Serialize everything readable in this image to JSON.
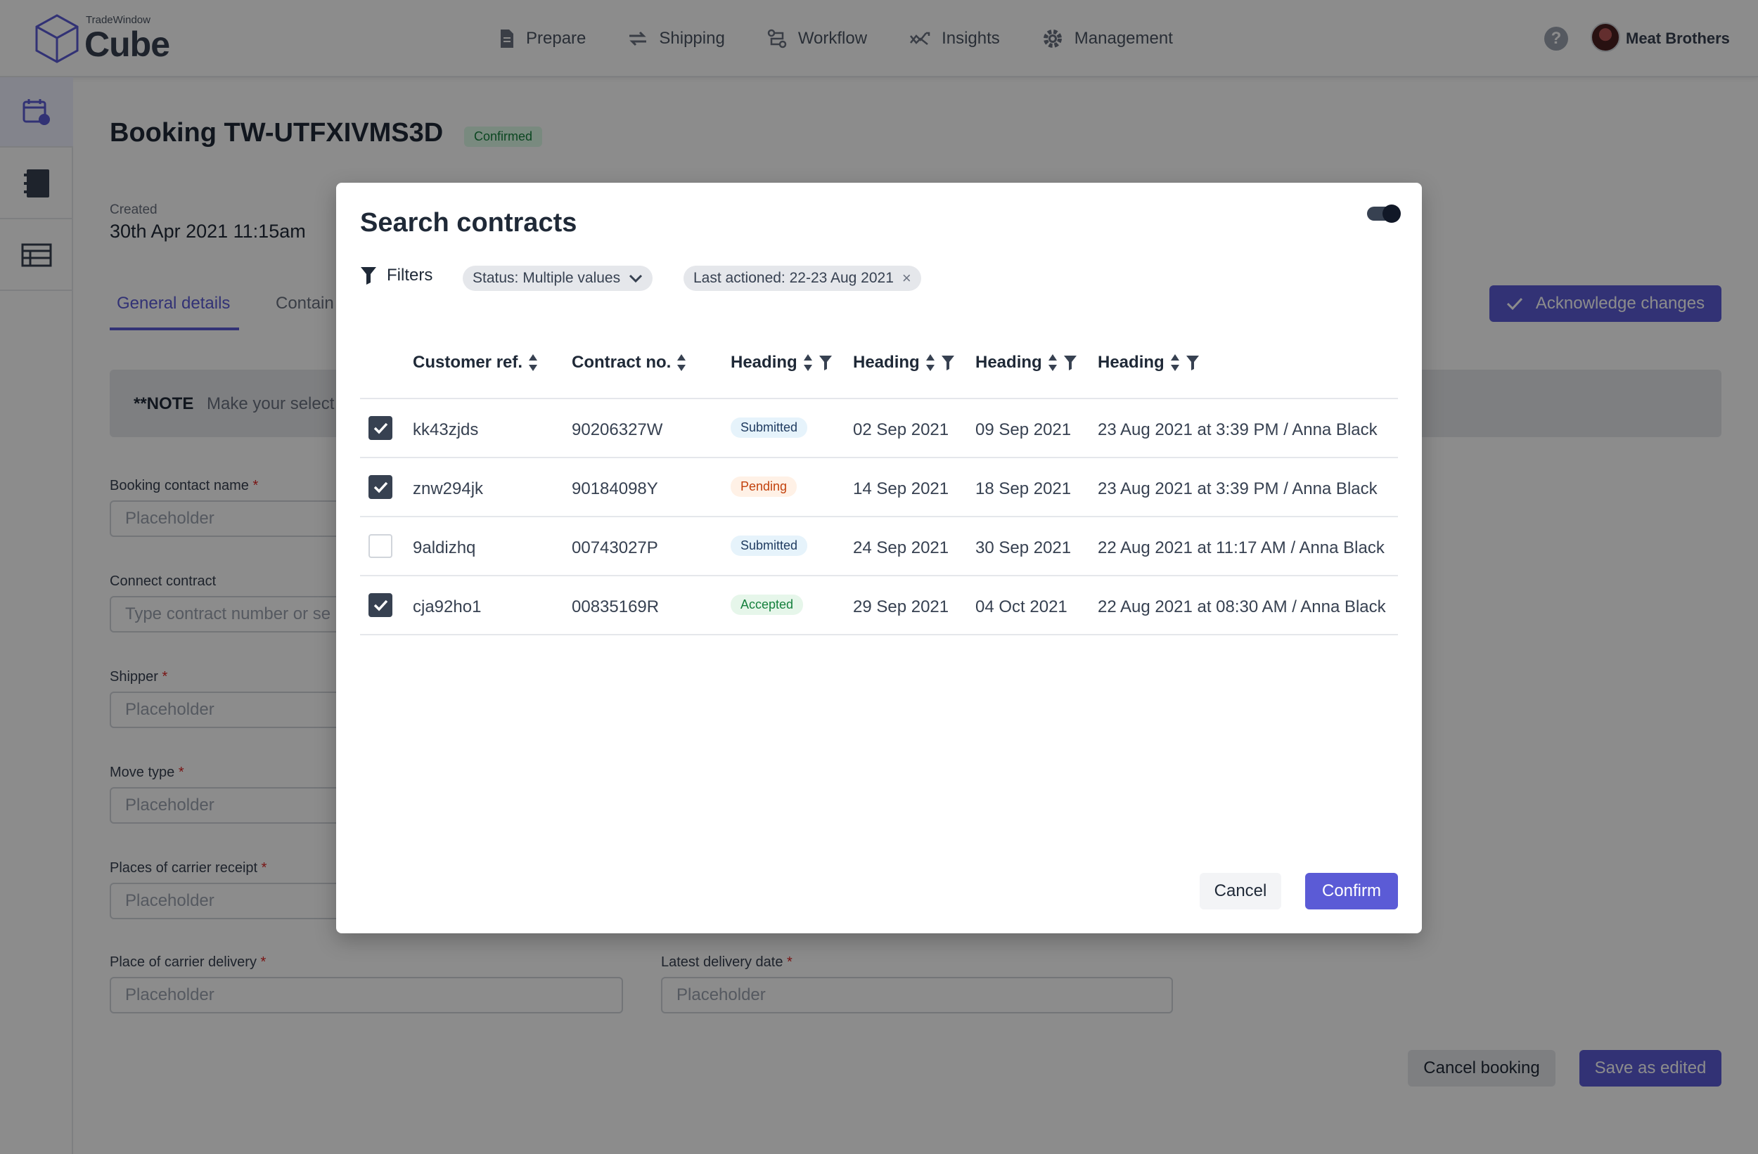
{
  "header": {
    "brand_small": "TradeWindow",
    "brand_big": "Cube",
    "nav": [
      {
        "label": "Prepare",
        "icon": "document-icon"
      },
      {
        "label": "Shipping",
        "icon": "arrows-swap-icon"
      },
      {
        "label": "Workflow",
        "icon": "workflow-icon"
      },
      {
        "label": "Insights",
        "icon": "trend-icon"
      },
      {
        "label": "Management",
        "icon": "gear-icon"
      }
    ],
    "help": "?",
    "company": "Meat Brothers"
  },
  "rail": [
    "calendar-clock-icon",
    "notebook-icon",
    "table-icon"
  ],
  "page": {
    "title": "Booking TW-UTFXIVMS3D",
    "status": "Confirmed",
    "created_label": "Created",
    "created_value": "30th Apr 2021 11:15am",
    "tabs": [
      "General details",
      "Contain"
    ],
    "ack_button": "Acknowledge changes",
    "note_strong": "**NOTE",
    "note_text": "Make your select",
    "fields": [
      {
        "label": "Booking contact name",
        "placeholder": "Placeholder"
      },
      {
        "label": "Connect contract",
        "placeholder": "Type contract number or se"
      },
      {
        "label": "Shipper",
        "placeholder": "Placeholder"
      },
      {
        "label": "Move type",
        "placeholder": "Placeholder"
      },
      {
        "label": "Places of carrier receipt",
        "placeholder": "Placeholder"
      },
      {
        "label": "Place of carrier delivery",
        "placeholder": "Placeholder"
      },
      {
        "label": "Latest delivery date",
        "placeholder": "Placeholder"
      }
    ],
    "required_mark": "*",
    "cancel_booking": "Cancel booking",
    "save_edited": "Save as edited"
  },
  "modal": {
    "title": "Search contracts",
    "filters_label": "Filters",
    "chip_status": "Status: Multiple values",
    "chip_date": "Last actioned: 22-23 Aug 2021",
    "chip_close": "×",
    "columns": [
      "Customer ref.",
      "Contract no.",
      "Heading",
      "Heading",
      "Heading",
      "Heading"
    ],
    "rows": [
      {
        "checked": true,
        "ref": "kk43zjds",
        "contract": "90206327W",
        "status": "Submitted",
        "status_kind": "submitted",
        "date1": "02 Sep 2021",
        "date2": "09 Sep 2021",
        "actioned": "23 Aug 2021 at 3:39 PM / Anna Black"
      },
      {
        "checked": true,
        "ref": "znw294jk",
        "contract": "90184098Y",
        "status": "Pending",
        "status_kind": "pending",
        "date1": "14 Sep 2021",
        "date2": "18 Sep 2021",
        "actioned": "23 Aug 2021 at 3:39 PM / Anna Black"
      },
      {
        "checked": false,
        "ref": "9aldizhq",
        "contract": "00743027P",
        "status": "Submitted",
        "status_kind": "submitted",
        "date1": "24 Sep 2021",
        "date2": "30 Sep 2021",
        "actioned": "22 Aug 2021 at 11:17 AM / Anna Black"
      },
      {
        "checked": true,
        "ref": "cja92ho1",
        "contract": "00835169R",
        "status": "Accepted",
        "status_kind": "accepted",
        "date1": "29 Sep 2021",
        "date2": "04 Oct 2021",
        "actioned": "22 Aug 2021 at 08:30 AM / Anna Black"
      }
    ],
    "cancel": "Cancel",
    "confirm": "Confirm"
  },
  "colors": {
    "accent": "#5b5bd6",
    "overlay": "rgba(0,0,0,0.45)",
    "submitted": "#1e3a5f",
    "pending": "#c2410c",
    "accepted": "#15803d"
  }
}
